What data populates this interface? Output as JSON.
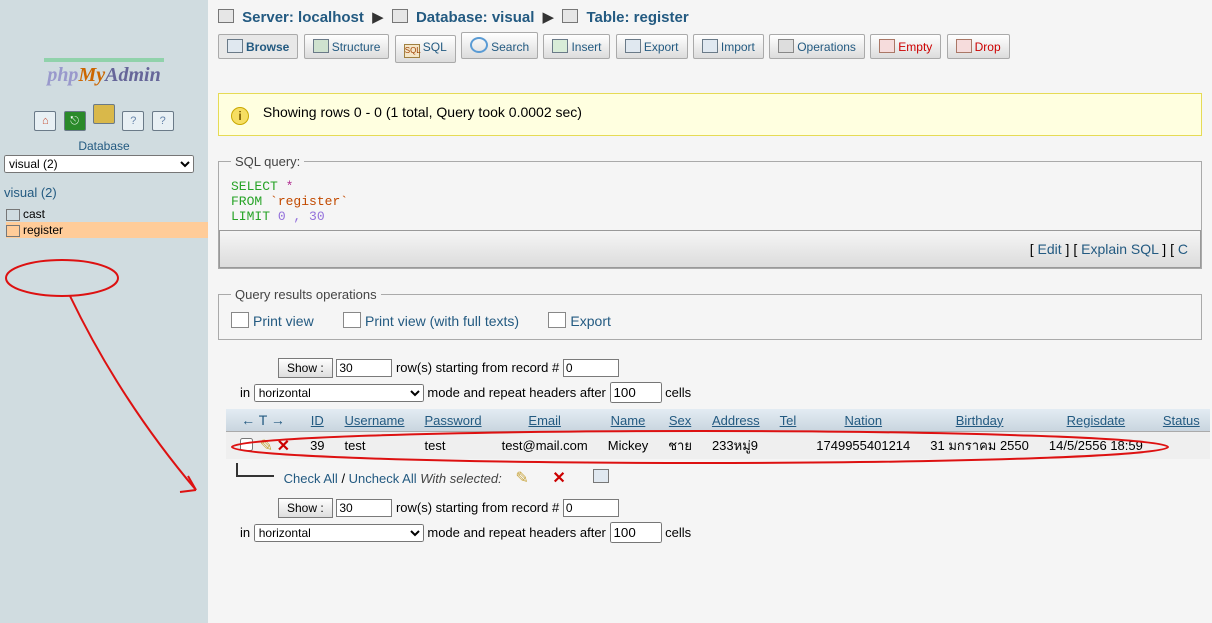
{
  "logo": {
    "p1": "php",
    "p2": "My",
    "p3": "Admin"
  },
  "sidebar": {
    "db_label": "Database",
    "db_select": "visual (2)",
    "db_link": "visual (2)",
    "tables": [
      {
        "name": "cast",
        "sel": false
      },
      {
        "name": "register",
        "sel": true
      }
    ]
  },
  "crumb": {
    "server_lbl": "Server:",
    "server": "localhost",
    "db_lbl": "Database:",
    "db": "visual",
    "tbl_lbl": "Table:",
    "tbl": "register"
  },
  "tabs": {
    "browse": "Browse",
    "structure": "Structure",
    "sql": "SQL",
    "search": "Search",
    "insert": "Insert",
    "export": "Export",
    "import": "Import",
    "operations": "Operations",
    "empty": "Empty",
    "drop": "Drop"
  },
  "notice": "Showing rows 0 - 0 (1 total, Query took 0.0002 sec)",
  "sqlbox": {
    "legend": "SQL query:",
    "select": "SELECT",
    "star": "*",
    "from": "FROM",
    "tbl": "`register`",
    "limit": "LIMIT",
    "range": "0 , 30",
    "edit": "Edit",
    "explain": "Explain SQL",
    "c": "C"
  },
  "qops": {
    "legend": "Query results operations",
    "print": "Print view",
    "printfull": "Print view (with full texts)",
    "export": "Export"
  },
  "showline": {
    "btn": "Show :",
    "rows": "30",
    "mid": "row(s) starting from record #",
    "start": "0"
  },
  "modeline": {
    "in": "in",
    "mode": "horizontal",
    "mid": "mode and repeat headers after",
    "hdr": "100",
    "cells": "cells"
  },
  "cols": [
    "ID",
    "Username",
    "Password",
    "Email",
    "Name",
    "Sex",
    "Address",
    "Tel",
    "Nation",
    "Birthday",
    "Regisdate",
    "Status"
  ],
  "row": {
    "ID": "39",
    "Username": "test",
    "Password": "test",
    "Email": "test@mail.com",
    "Name": "Mickey",
    "Sex": "ชาย",
    "Address": "233หมู่9",
    "Tel": "",
    "Nation": "1749955401214",
    "Birthday": "31 มกราคม 2550",
    "Regisdate": "14/5/2556 18:59",
    "Status": ""
  },
  "chk": {
    "checkall": "Check All",
    "uncheckall": "Uncheck All",
    "withsel": "With selected:"
  }
}
